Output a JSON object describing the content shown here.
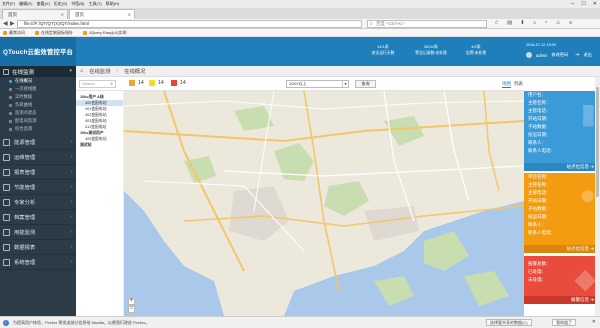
{
  "browser": {
    "menu": [
      "文件(F)",
      "编辑(E)",
      "查看(V)",
      "历史(S)",
      "书签(B)",
      "工具(T)",
      "帮助(H)"
    ],
    "tabs": [
      {
        "label": "首页"
      },
      {
        "label": "首页"
      }
    ],
    "url": "file:///F:/QT/QT(X)/QT/index.html",
    "search_placeholder": "百度 <Ctrl+K>",
    "bookmarks": [
      "最常访问",
      "在线定制鼠标指针",
      "JQuery Easy(UI)实例"
    ]
  },
  "app": {
    "title": "QTouch云能效管控平台",
    "stats": [
      {
        "value": "11/1条",
        "label": "安全运行天数"
      },
      {
        "value": "36/34条",
        "label": "警告记录数/未处理"
      },
      {
        "value": "4/2条",
        "label": "告警/未处理"
      }
    ],
    "datetime": "2016-07-12 15:00",
    "user": "admin",
    "change_password": "修改密码",
    "logout": "退出"
  },
  "sidebar": {
    "active_menu": "在线监测",
    "items": [
      {
        "label": "在线概况",
        "active": true
      },
      {
        "label": "一次接线图",
        "active": false
      },
      {
        "label": "实时数据",
        "active": false
      },
      {
        "label": "负荷曲线",
        "active": false
      },
      {
        "label": "监测点状态",
        "active": false
      },
      {
        "label": "配电间监测",
        "active": false
      },
      {
        "label": "综合监测",
        "active": false
      }
    ],
    "sections": [
      "能源管理",
      "运维管理",
      "报表管理",
      "节能管理",
      "专家分析",
      "档案管理",
      "用能监测",
      "数据报表",
      "系统管理"
    ]
  },
  "breadcrumb": {
    "section": "在线监测",
    "page": "在线概况"
  },
  "toolbar": {
    "search_placeholder": "Search",
    "legend": [
      {
        "color": "#f0a628",
        "count": "14"
      },
      {
        "color": "#f7dd1e",
        "count": "14"
      },
      {
        "color": "#e34336",
        "count": "14"
      }
    ],
    "select_value": "10KV以上",
    "query_button": "查询"
  },
  "map_tabs": [
    "地图",
    "列表"
  ],
  "tree": [
    {
      "label": "10kv用户 A线",
      "level": 0,
      "selected": false
    },
    {
      "label": "400变配电站",
      "level": 1,
      "selected": true
    },
    {
      "label": "401变配电站",
      "level": 1,
      "selected": false
    },
    {
      "label": "402变配电站",
      "level": 1,
      "selected": false
    },
    {
      "label": "403变配电站",
      "level": 1,
      "selected": false
    },
    {
      "label": "411变配电站",
      "level": 1,
      "selected": false
    },
    {
      "label": "10kv测试用户",
      "level": 0,
      "selected": false
    },
    {
      "label": "400变配电站",
      "level": 1,
      "selected": false
    },
    {
      "label": "测试站",
      "level": 0,
      "selected": false
    }
  ],
  "right_cards": [
    {
      "color": "#3b9ad8",
      "rows": [
        "用户名：",
        "主管名称：",
        "主管电话：",
        "开站日期：",
        "子站数据：",
        "投运日期：",
        "联系人：",
        "联系人电话："
      ],
      "footer": "站点位信息 ➔"
    },
    {
      "color": "#f39c12",
      "rows": [
        "单位名称：",
        "主管名称：",
        "主管电话：",
        "开站日期：",
        "子站数据：",
        "投运日期：",
        "联系人：",
        "联系人电话："
      ],
      "footer": "站点位信息 ➔"
    },
    {
      "color": "#e74c3c",
      "rows": [
        "报警总数：",
        "已处理：",
        "未处理："
      ],
      "footer": "报警信息 ➔"
    }
  ],
  "statusbar": {
    "message": "为提高用户体验，Firefox 将发送部分信息给 Mozilla，以便我们改进 Firefox。",
    "button1": "选择要共享的数据(C)",
    "button2": "我知道了"
  }
}
